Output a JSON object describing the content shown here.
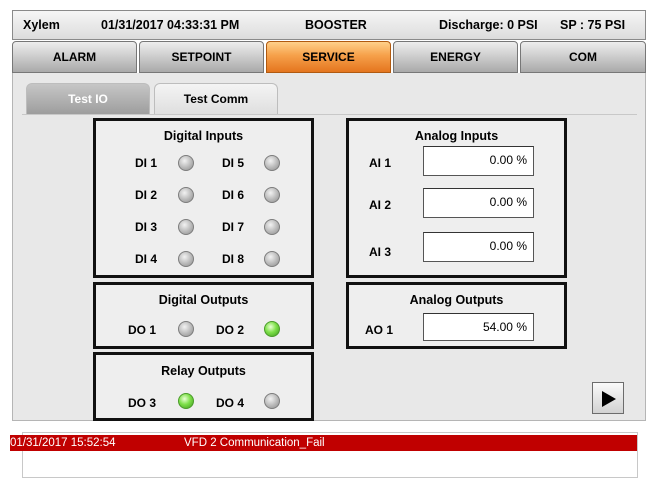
{
  "header": {
    "title": "Xylem",
    "datetime": "01/31/2017 04:33:31 PM",
    "mode": "BOOSTER",
    "discharge": "Discharge: 0 PSI",
    "setpoint": "SP : 75 PSI"
  },
  "nav": [
    {
      "label": "ALARM",
      "active": false
    },
    {
      "label": "SETPOINT",
      "active": false
    },
    {
      "label": "SERVICE",
      "active": true
    },
    {
      "label": "ENERGY",
      "active": false
    },
    {
      "label": "COM",
      "active": false
    }
  ],
  "subtabs": {
    "test_io": "Test IO",
    "test_comm": "Test Comm"
  },
  "digital_inputs": {
    "title": "Digital Inputs",
    "items": [
      {
        "label": "DI 1",
        "on": false
      },
      {
        "label": "DI 5",
        "on": false
      },
      {
        "label": "DI 2",
        "on": false
      },
      {
        "label": "DI 6",
        "on": false
      },
      {
        "label": "DI 3",
        "on": false
      },
      {
        "label": "DI 7",
        "on": false
      },
      {
        "label": "DI 4",
        "on": false
      },
      {
        "label": "DI 8",
        "on": false
      }
    ]
  },
  "digital_outputs": {
    "title": "Digital Outputs",
    "items": [
      {
        "label": "DO 1",
        "on": false
      },
      {
        "label": "DO 2",
        "on": true
      }
    ]
  },
  "relay_outputs": {
    "title": "Relay Outputs",
    "items": [
      {
        "label": "DO 3",
        "on": true
      },
      {
        "label": "DO 4",
        "on": false
      }
    ]
  },
  "analog_inputs": {
    "title": "Analog Inputs",
    "items": [
      {
        "label": "AI 1",
        "value": "0.00 %"
      },
      {
        "label": "AI 2",
        "value": "0.00 %"
      },
      {
        "label": "AI 3",
        "value": "0.00 %"
      }
    ]
  },
  "analog_outputs": {
    "title": "Analog Outputs",
    "items": [
      {
        "label": "AO 1",
        "value": "54.00 %"
      }
    ]
  },
  "alarm": {
    "timestamp": "01/31/2017 15:52:54",
    "message": "VFD 2 Communication_Fail"
  },
  "icons": {
    "next": "play-icon"
  },
  "colors": {
    "active_tab": "#f6a04a",
    "alarm_bg": "#c00000",
    "led_on": "#7ee04a",
    "led_off": "#b8b8b8"
  }
}
